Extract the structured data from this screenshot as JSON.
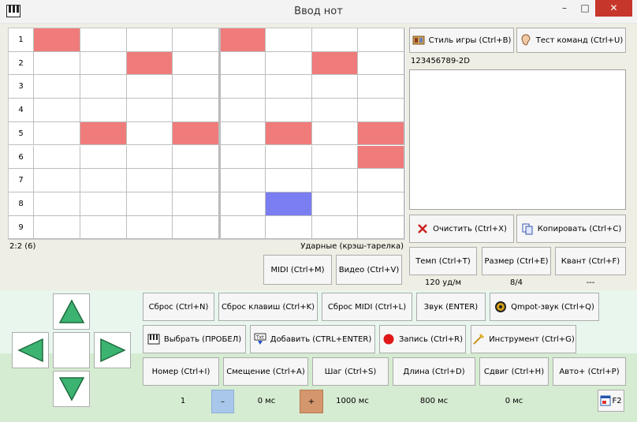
{
  "window": {
    "title": "Ввод нот",
    "min_label": "–",
    "max_label": "□",
    "close_label": "✕"
  },
  "grid": {
    "rows": [
      "1",
      "2",
      "3",
      "4",
      "5",
      "6",
      "7",
      "8",
      "9"
    ],
    "columns": 8,
    "colors": {
      "red": "#f07b7b",
      "blue": "#7a7ef0",
      "line": "#bdbdbd"
    },
    "filled": [
      {
        "row": 1,
        "col": 1,
        "color": "red"
      },
      {
        "row": 1,
        "col": 5,
        "color": "red"
      },
      {
        "row": 2,
        "col": 3,
        "color": "red"
      },
      {
        "row": 2,
        "col": 7,
        "color": "red"
      },
      {
        "row": 5,
        "col": 2,
        "color": "red"
      },
      {
        "row": 5,
        "col": 4,
        "color": "red"
      },
      {
        "row": 5,
        "col": 6,
        "color": "red"
      },
      {
        "row": 5,
        "col": 8,
        "color": "red"
      },
      {
        "row": 6,
        "col": 8,
        "color": "red"
      },
      {
        "row": 8,
        "col": 6,
        "color": "blue"
      }
    ],
    "position_label": "2:2 (6)",
    "instrument_label": "Ударные (крэш-тарелка)"
  },
  "right": {
    "style_button": "Стиль игры (Ctrl+B)",
    "test_button": "Тест команд (Ctrl+U)",
    "code_text": "123456789-2D",
    "clear_button": "Очистить (Ctrl+X)",
    "copy_button": "Копировать (Ctrl+C)",
    "tempo_button": "Темп (Ctrl+T)",
    "size_button": "Размер (Ctrl+E)",
    "quant_button": "Квант (Ctrl+F)",
    "tempo_value": "120 уд/м",
    "size_value": "8/4",
    "quant_value": "---"
  },
  "media": {
    "midi_button": "MIDI (Ctrl+M)",
    "video_button": "Видео (Ctrl+V)"
  },
  "row1": {
    "reset": "Сброс (Ctrl+N)",
    "reset_keys": "Сброс клавиш (Ctrl+K)",
    "reset_midi": "Сброс MIDI (Ctrl+L)",
    "sound": "Звук (ENTER)",
    "qmpot": "Qmpot-звук (Ctrl+Q)"
  },
  "row2": {
    "select": "Выбрать (ПРОБЕЛ)",
    "add": "Добавить (CTRL+ENTER)",
    "record": "Запись (Ctrl+R)",
    "instrument": "Инструмент (Ctrl+G)"
  },
  "row3": {
    "number": "Номер (Ctrl+I)",
    "offset": "Смещение (Ctrl+A)",
    "step": "Шаг (Ctrl+S)",
    "length": "Длина (Ctrl+D)",
    "shift": "Сдвиг (Ctrl+H)",
    "auto": "Авто+ (Ctrl+P)"
  },
  "values": {
    "number": "1",
    "offset": "0 мс",
    "step": "1000 мс",
    "length": "800 мс",
    "shift": "0 мс",
    "minus": "–",
    "plus": "+",
    "f2": "F2"
  }
}
